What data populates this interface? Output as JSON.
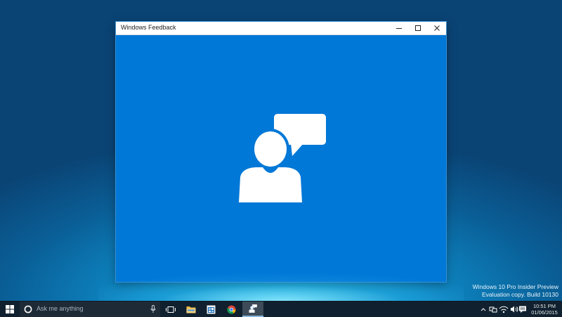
{
  "window": {
    "title": "Windows Feedback",
    "app_icon": "person-speech-bubble-icon",
    "background_color": "#0078d7"
  },
  "desktop": {
    "watermark_line1": "Windows 10 Pro Insider Preview",
    "watermark_line2": "Evaluation copy. Build 10130"
  },
  "taskbar": {
    "search_placeholder": "Ask me anything",
    "pinned_apps": [
      "task-view",
      "file-explorer",
      "store",
      "chrome",
      "windows-feedback"
    ],
    "active_app": "windows-feedback",
    "clock_time": "10:51 PM",
    "clock_date": "01/06/2015"
  },
  "colors": {
    "accent": "#0078d7",
    "taskbar": "#10202e"
  }
}
